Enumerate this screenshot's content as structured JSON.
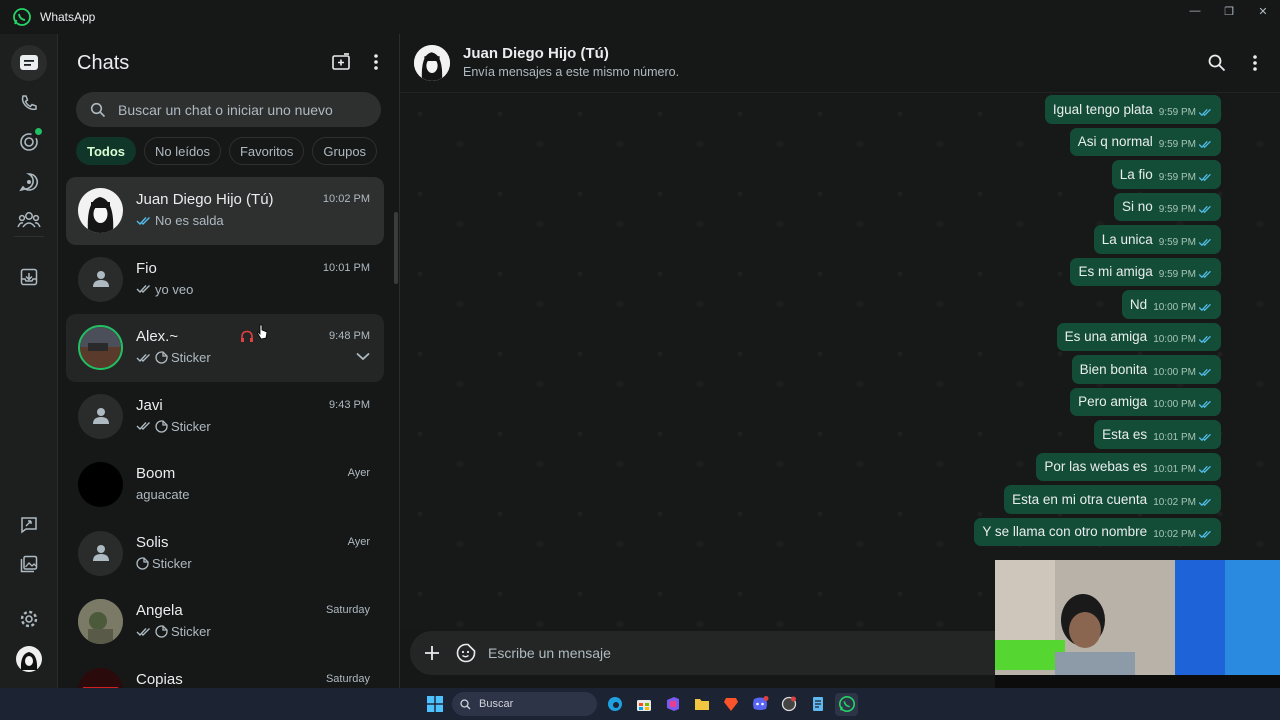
{
  "app": {
    "title": "WhatsApp"
  },
  "sidebar": {
    "title": "Chats",
    "search_placeholder": "Buscar un chat o iniciar uno nuevo",
    "filters": [
      "Todos",
      "No leídos",
      "Favoritos",
      "Grupos"
    ],
    "chats": [
      {
        "name": "Juan Diego Hijo (Tú)",
        "time": "10:02 PM",
        "preview": "No es salda",
        "ticks": "read"
      },
      {
        "name": "Fio",
        "time": "10:01 PM",
        "preview": "yo veo",
        "ticks": "delivered"
      },
      {
        "name": "Alex.~",
        "time": "9:48 PM",
        "preview": "Sticker",
        "ticks": "delivered"
      },
      {
        "name": "Javi",
        "time": "9:43 PM",
        "preview": "Sticker",
        "ticks": "delivered"
      },
      {
        "name": "Boom",
        "time": "Ayer",
        "preview": "aguacate",
        "ticks": "none"
      },
      {
        "name": "Solis",
        "time": "Ayer",
        "preview": "Sticker",
        "ticks": "none"
      },
      {
        "name": "Angela",
        "time": "Saturday",
        "preview": "Sticker",
        "ticks": "delivered"
      },
      {
        "name": "Copias",
        "time": "Saturday",
        "preview": "",
        "ticks": "none"
      }
    ]
  },
  "conversation": {
    "title": "Juan Diego Hijo (Tú)",
    "subtitle": "Envía mensajes a este mismo número.",
    "messages": [
      {
        "text": "Igual tengo plata",
        "time": "9:59 PM"
      },
      {
        "text": "Asi q normal",
        "time": "9:59 PM"
      },
      {
        "text": "La fio",
        "time": "9:59 PM"
      },
      {
        "text": "Si no",
        "time": "9:59 PM"
      },
      {
        "text": "La unica",
        "time": "9:59 PM"
      },
      {
        "text": "Es mi amiga",
        "time": "9:59 PM"
      },
      {
        "text": "Nd",
        "time": "10:00 PM"
      },
      {
        "text": "Es una amiga",
        "time": "10:00 PM"
      },
      {
        "text": "Bien bonita",
        "time": "10:00 PM"
      },
      {
        "text": "Pero amiga",
        "time": "10:00 PM"
      },
      {
        "text": "Esta es",
        "time": "10:01 PM"
      },
      {
        "text": "Por las webas es",
        "time": "10:01 PM"
      },
      {
        "text": "Esta en mi otra cuenta",
        "time": "10:02 PM"
      },
      {
        "text": "Y se llama con otro nombre",
        "time": "10:02 PM"
      }
    ],
    "composer_placeholder": "Escribe un mensaje"
  },
  "taskbar": {
    "search_label": "Buscar"
  },
  "colors": {
    "accent": "#21c063",
    "bubble": "#144d37",
    "read_tick": "#53bdeb"
  }
}
